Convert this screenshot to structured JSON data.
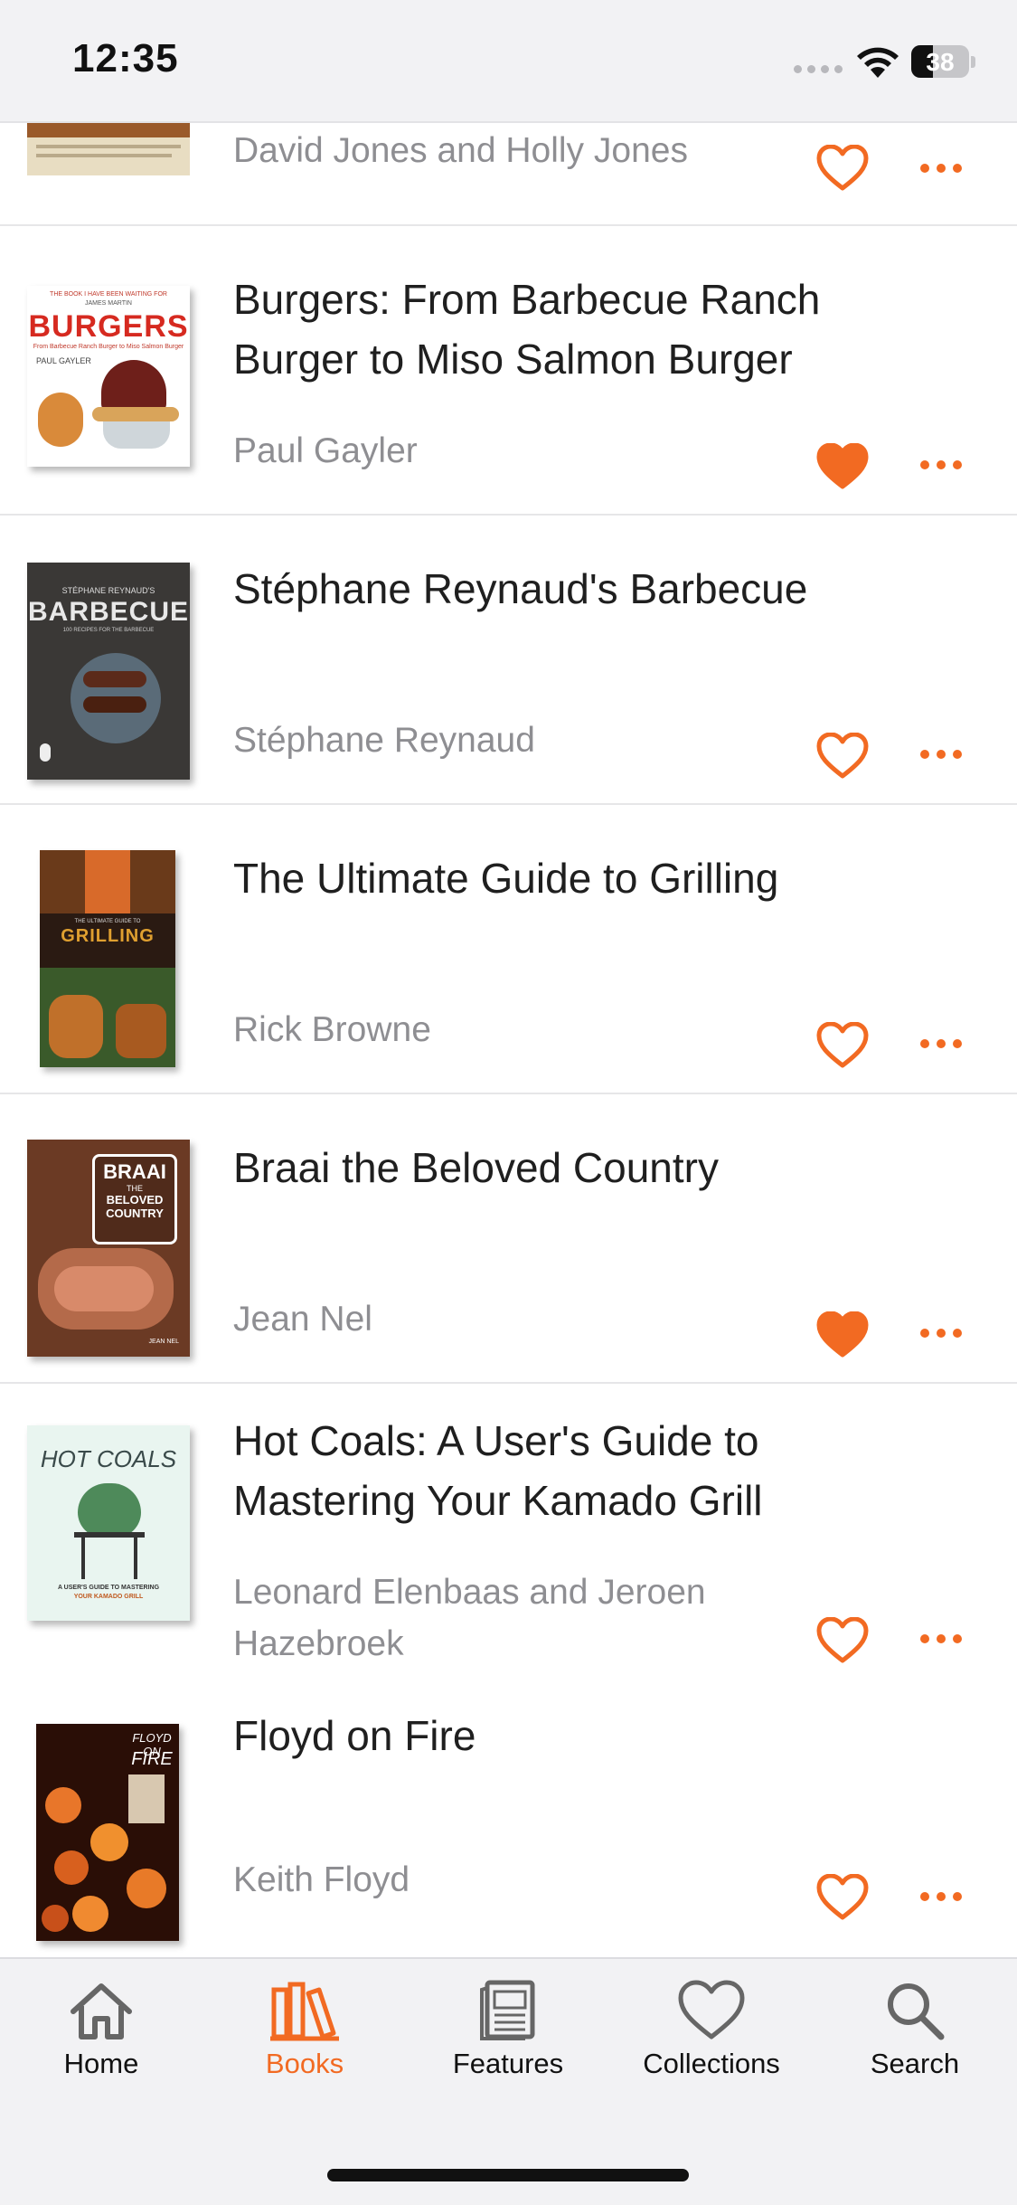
{
  "status_bar": {
    "time": "12:35",
    "battery": "38"
  },
  "books": [
    {
      "title": "",
      "author": "David Jones and Holly Jones",
      "favorited": false
    },
    {
      "title": "Burgers: From Barbecue Ranch Burger to Miso Salmon Burger",
      "author": "Paul Gayler",
      "favorited": true,
      "cover": {
        "top_text": "THE BOOK I HAVE BEEN WAITING FOR",
        "top_text2": "JAMES MARTIN",
        "title": "BURGERS",
        "subtitle": "From Barbecue Ranch Burger to Miso Salmon Burger",
        "author": "PAUL GAYLER"
      }
    },
    {
      "title": "Stéphane Reynaud's Barbecue",
      "author": "Stéphane Reynaud",
      "favorited": false,
      "cover": {
        "top_text": "STÉPHANE REYNAUD'S",
        "title": "BARBECUE",
        "subtitle": "100 RECIPES FOR THE BARBECUE"
      }
    },
    {
      "title": "The Ultimate Guide to Grilling",
      "author": "Rick Browne",
      "favorited": false,
      "cover": {
        "top_text": "THE ULTIMATE GUIDE TO",
        "title": "GRILLING"
      }
    },
    {
      "title": "Braai the Beloved Country",
      "author": "Jean Nel",
      "favorited": true,
      "cover": {
        "title_line1": "BRAAI",
        "title_line2": "THE",
        "title_line3": "BELOVED",
        "title_line4": "COUNTRY",
        "author": "JEAN NEL"
      }
    },
    {
      "title": "Hot Coals: A User's Guide to Mastering Your Kamado Grill",
      "author": "Leonard Elenbaas and Jeroen Hazebroek",
      "favorited": false,
      "cover": {
        "title": "HOT COALS",
        "subtitle_line1": "A USER'S GUIDE TO MASTERING",
        "subtitle_line2": "YOUR KAMADO GRILL"
      }
    },
    {
      "title": "Floyd on Fire",
      "author": "Keith Floyd",
      "favorited": false,
      "cover": {
        "title_line1": "FLOYD ON",
        "title_line2": "FIRE"
      }
    }
  ],
  "tabs": [
    {
      "label": "Home",
      "icon": "home-icon",
      "active": false
    },
    {
      "label": "Books",
      "icon": "books-icon",
      "active": true
    },
    {
      "label": "Features",
      "icon": "features-icon",
      "active": false
    },
    {
      "label": "Collections",
      "icon": "collections-icon",
      "active": false
    },
    {
      "label": "Search",
      "icon": "search-icon",
      "active": false
    }
  ],
  "colors": {
    "accent": "#f26a22",
    "text": "#1f1f1f",
    "secondary_text": "#8e8e92",
    "tab_bar": "#f2f2f4"
  }
}
